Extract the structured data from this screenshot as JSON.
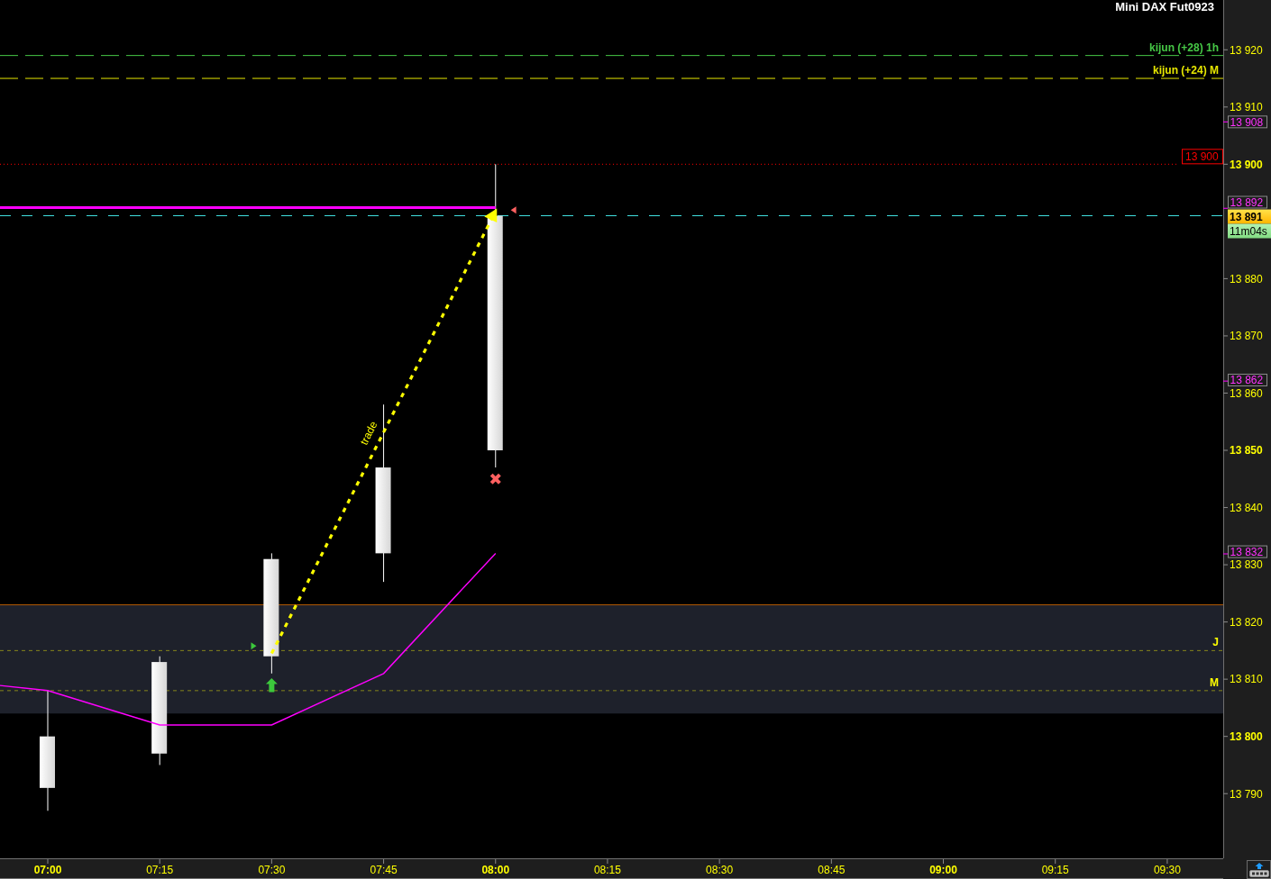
{
  "chart_data": {
    "type": "line",
    "title": "Mini DAX Fut0923",
    "x": [
      413.6,
      420,
      435,
      450,
      465,
      480
    ],
    "xlim": [
      413.6,
      577.5
    ],
    "ylim": [
      13778.7,
      13928.7
    ],
    "xticks": [
      {
        "value": 420,
        "label": "07:00"
      },
      {
        "value": 435,
        "label": "07:15"
      },
      {
        "value": 450,
        "label": "07:30"
      },
      {
        "value": 465,
        "label": "07:45"
      },
      {
        "value": 480,
        "label": "08:00"
      },
      {
        "value": 495,
        "label": "08:15"
      },
      {
        "value": 510,
        "label": "08:30"
      },
      {
        "value": 525,
        "label": "08:45"
      },
      {
        "value": 540,
        "label": "09:00"
      },
      {
        "value": 555,
        "label": "09:15"
      },
      {
        "value": 570,
        "label": "09:30"
      }
    ],
    "yticks": [
      {
        "value": 13920,
        "label": "13 920"
      },
      {
        "value": 13910,
        "label": "13 910"
      },
      {
        "value": 13900,
        "label": "13 900"
      },
      {
        "value": 13880,
        "label": "13 880"
      },
      {
        "value": 13870,
        "label": "13 870"
      },
      {
        "value": 13860,
        "label": "13 860"
      },
      {
        "value": 13850,
        "label": "13 850"
      },
      {
        "value": 13840,
        "label": "13 840"
      },
      {
        "value": 13830,
        "label": "13 830"
      },
      {
        "value": 13820,
        "label": "13 820"
      },
      {
        "value": 13810,
        "label": "13 810"
      },
      {
        "value": 13800,
        "label": "13 800"
      },
      {
        "value": 13790,
        "label": "13 790"
      }
    ],
    "series": [
      {
        "color": "#ff00ff",
        "values": [
          13808.9,
          13808,
          13802,
          13802,
          13811,
          13832
        ]
      },
      {
        "color": "#ff00ff",
        "values": [
          13892.4,
          13892.4,
          13892.4,
          13892.4,
          13892.4,
          13892.4
        ]
      }
    ],
    "bands": [
      {
        "axis": "y",
        "from": 13804,
        "to": 13823,
        "color": "#1e212b"
      }
    ],
    "ref_lines": [
      {
        "axis": "y",
        "value": 13823,
        "color": "#b35a00"
      },
      {
        "axis": "y",
        "value": 13919,
        "label": "kijun (+28) 1h",
        "color": "#46c846"
      },
      {
        "axis": "y",
        "value": 13915,
        "label": "kijun (+24) M",
        "color": "#e6e600"
      },
      {
        "axis": "y",
        "value": 13900,
        "label": "13 900",
        "color": "#ff0000"
      },
      {
        "axis": "y",
        "value": 13815,
        "label": "J",
        "color": "#86861a"
      },
      {
        "axis": "y",
        "value": 13808,
        "label": "M",
        "color": "#86861a"
      },
      {
        "axis": "y",
        "value": 13891,
        "label": "13 891",
        "color": "#40e0e0"
      }
    ],
    "annotations": [
      "trade"
    ]
  },
  "countdown": "11m04s",
  "axis_tags": [
    "13 908",
    "13 892",
    "13 862",
    "13 832"
  ]
}
